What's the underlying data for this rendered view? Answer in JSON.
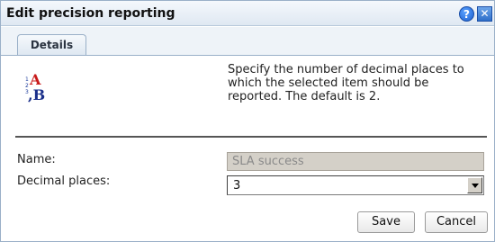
{
  "dialog": {
    "title": "Edit precision reporting",
    "help_glyph": "?",
    "close_glyph": "✕"
  },
  "tabs": [
    {
      "label": "Details",
      "selected": true
    }
  ],
  "description": "Specify the number of decimal places to which the selected item should be reported. The default is 2.",
  "form": {
    "name_label": "Name:",
    "name_value": "SLA success",
    "name_disabled": true,
    "decimal_label": "Decimal places:",
    "decimal_value": "3"
  },
  "buttons": {
    "save_label": "Save",
    "cancel_label": "Cancel"
  },
  "icons": {
    "title_help": "help-icon",
    "title_close": "close-icon",
    "dialog_icon": "number-format-icon"
  }
}
